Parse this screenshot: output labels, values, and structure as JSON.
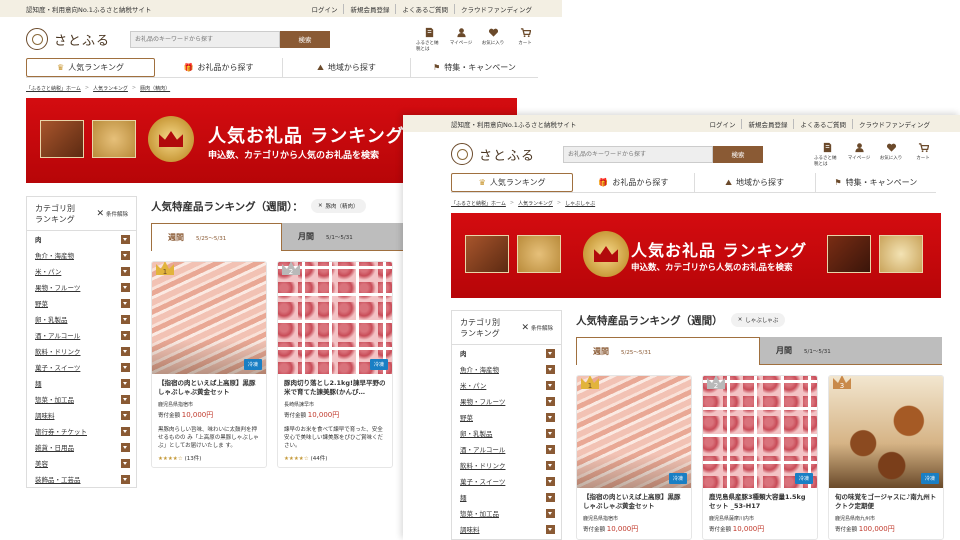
{
  "topbar": {
    "tagline": "認知度・利用意向No.1ふるさと納税サイト",
    "links": [
      "ログイン",
      "新規会員登録",
      "よくあるご質問",
      "クラウドファンディング"
    ]
  },
  "header": {
    "logo_text": "さとふる",
    "search_placeholder": "お礼品のキーワードから探す",
    "search_button": "検索",
    "icons": [
      {
        "icon": "book-icon",
        "label": "ふるさと納税とは"
      },
      {
        "icon": "person-icon",
        "label": "マイページ"
      },
      {
        "icon": "heart-icon",
        "label": "お気に入り"
      },
      {
        "icon": "cart-icon",
        "label": "カート"
      }
    ]
  },
  "nav": [
    "人気ランキング",
    "お礼品から探す",
    "地域から探す",
    "特集・キャンペーン"
  ],
  "windowA": {
    "breadcrumb": [
      "「ふるさと納税」ホーム",
      "人気ランキング",
      "豚肉（精肉）"
    ],
    "filter_chip": "豚肉（精肉）",
    "cards": [
      {
        "rank": "1",
        "name": "【指宿の肉といえば上高原】黒豚しゃぶしゃぶ黄金セット",
        "pref": "鹿児島県指宿市",
        "price_label": "寄付金額",
        "price": "10,000円",
        "badge": "冷凍",
        "desc": "黒豚肉らしい旨味、味わいに太鼓判を押せるものの み「上高原の黒豚しゃぶしゃぶ」としてお届けいたしま す。",
        "stars": "★★★★☆",
        "count": "(13件)"
      },
      {
        "rank": "2",
        "name": "豚肉切り落とし2.1kg!諫早平野の米で育てた諫美豚(かんび…",
        "pref": "長崎県諫早市",
        "price_label": "寄付金額",
        "price": "10,000円",
        "badge": "冷凍",
        "desc": "諫早のお米を食べて諫早で育った、安全安心で美味しい諫美豚をぴひご賞味ください。",
        "stars": "★★★★☆",
        "count": "(44件)"
      }
    ]
  },
  "windowB": {
    "breadcrumb": [
      "「ふるさと納税」ホーム",
      "人気ランキング",
      "しゃぶしゃぶ"
    ],
    "filter_chip": "しゃぶしゃぶ",
    "cards": [
      {
        "rank": "1",
        "name": "【指宿の肉といえば上高原】黒豚しゃぶしゃぶ黄金セット",
        "pref": "鹿児島県指宿市",
        "price_label": "寄付金額",
        "price": "10,000円",
        "badge": "冷凍"
      },
      {
        "rank": "2",
        "name": "鹿児島県産豚3種類大容量1.5kgセット _53-H17",
        "pref": "鹿児島県薩摩川内市",
        "price_label": "寄付金額",
        "price": "10,000円",
        "badge": "冷凍"
      },
      {
        "rank": "3",
        "name": "旬の味覚をゴージャスに♪南九州トクトク定期便",
        "pref": "鹿児島県南九州市",
        "price_label": "寄付金額",
        "price": "100,000円",
        "badge": "冷凍"
      }
    ]
  },
  "banner": {
    "title": "人気お礼品 ランキング",
    "subtitle": "申込数、カテゴリから人気のお礼品を検索"
  },
  "sidebar": {
    "title": "カテゴリ別\nランキング",
    "clear": "条件解除",
    "categories": [
      "肉",
      "魚介・海産物",
      "米・パン",
      "果物・フルーツ",
      "野菜",
      "卵・乳製品",
      "酒・アルコール",
      "飲料・ドリンク",
      "菓子・スイーツ",
      "麺",
      "惣菜・加工品",
      "調味料",
      "旅行券・チケット",
      "雑貨・日用品",
      "美容",
      "装飾品・工芸品"
    ]
  },
  "ranking": {
    "heading": "人気特産品ランキング（週間）：",
    "heading_b": "人気特産品ランキング（週間）",
    "tab_week": "週間",
    "tab_week_range": "5/25〜5/31",
    "tab_month": "月間",
    "tab_month_range": "5/1〜5/31"
  }
}
